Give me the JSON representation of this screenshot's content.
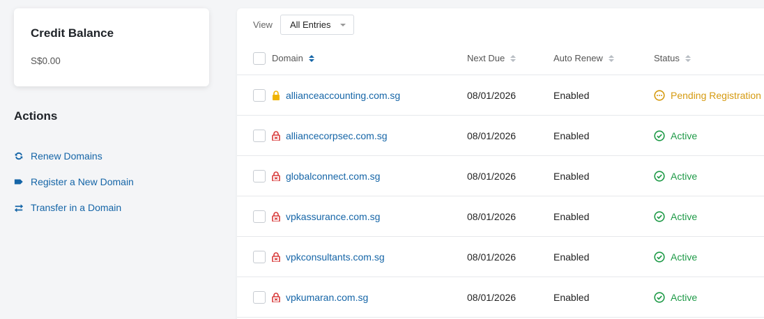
{
  "credit": {
    "title": "Credit Balance",
    "value": "S$0.00"
  },
  "actions": {
    "title": "Actions",
    "items": [
      {
        "label": "Renew Domains",
        "icon": "refresh-icon"
      },
      {
        "label": "Register a New Domain",
        "icon": "tag-icon"
      },
      {
        "label": "Transfer in a Domain",
        "icon": "transfer-icon"
      }
    ]
  },
  "view": {
    "label": "View",
    "selected": "All Entries"
  },
  "table": {
    "headers": {
      "domain": "Domain",
      "next_due": "Next Due",
      "auto_renew": "Auto Renew",
      "status": "Status"
    },
    "rows": [
      {
        "domain": "allianceaccounting.com.sg",
        "next_due": "08/01/2026",
        "auto_renew": "Enabled",
        "status": "Pending Registration",
        "lock": "locked",
        "state": "pending"
      },
      {
        "domain": "alliancecorpsec.com.sg",
        "next_due": "08/01/2026",
        "auto_renew": "Enabled",
        "status": "Active",
        "lock": "unlocked",
        "state": "active"
      },
      {
        "domain": "globalconnect.com.sg",
        "next_due": "08/01/2026",
        "auto_renew": "Enabled",
        "status": "Active",
        "lock": "unlocked",
        "state": "active"
      },
      {
        "domain": "vpkassurance.com.sg",
        "next_due": "08/01/2026",
        "auto_renew": "Enabled",
        "status": "Active",
        "lock": "unlocked",
        "state": "active"
      },
      {
        "domain": "vpkconsultants.com.sg",
        "next_due": "08/01/2026",
        "auto_renew": "Enabled",
        "status": "Active",
        "lock": "unlocked",
        "state": "active"
      },
      {
        "domain": "vpkumaran.com.sg",
        "next_due": "08/01/2026",
        "auto_renew": "Enabled",
        "status": "Active",
        "lock": "unlocked",
        "state": "active"
      }
    ]
  },
  "colors": {
    "link": "#1565a7",
    "active": "#1e9a47",
    "pending": "#d59a10",
    "lock_locked": "#f0b400",
    "lock_unlocked": "#d83a3a"
  }
}
